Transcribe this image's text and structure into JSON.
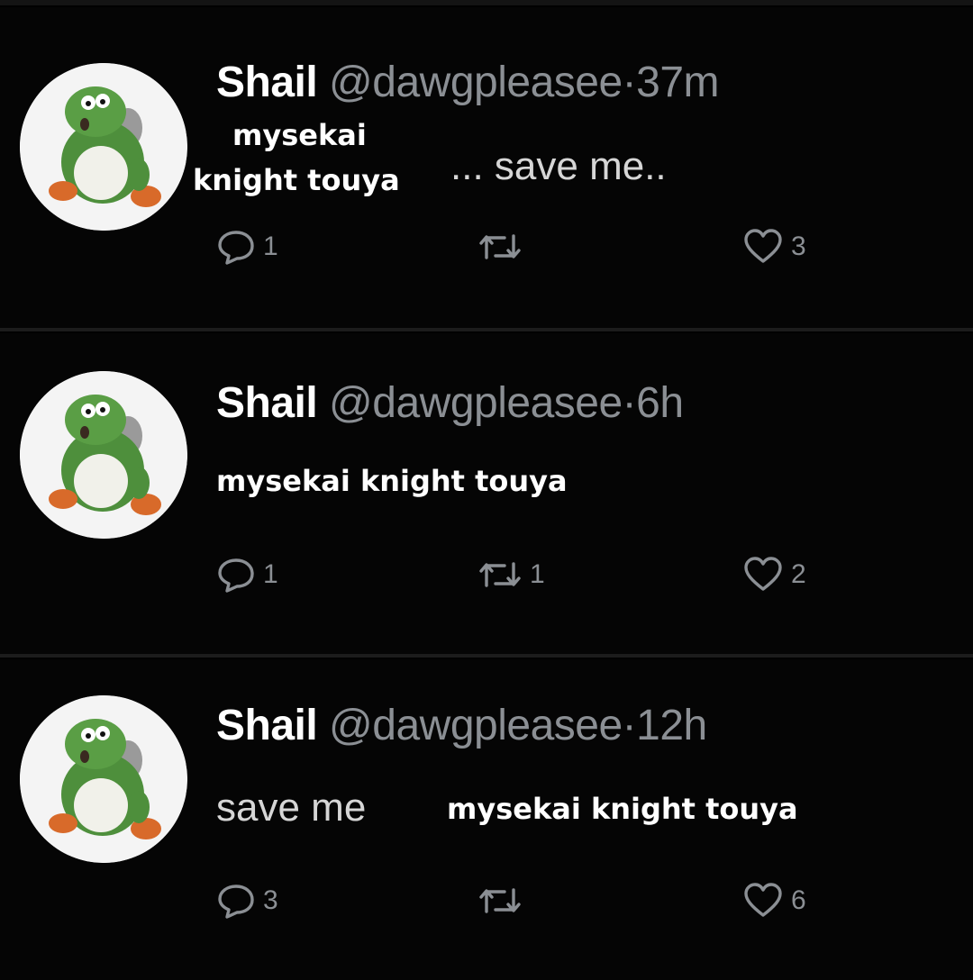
{
  "tweets": [
    {
      "author_name": "Shail",
      "handle": "@dawgpleasee",
      "separator": "·",
      "time": "37m",
      "text": "... save me..",
      "overlay_line1": "mysekai",
      "overlay_line2": "knight touya",
      "replies": "1",
      "retweets": "",
      "likes": "3"
    },
    {
      "author_name": "Shail",
      "handle": "@dawgpleasee",
      "separator": "·",
      "time": "6h",
      "text": "",
      "overlay_line1": "mysekai knight touya",
      "overlay_line2": "",
      "replies": "1",
      "retweets": "1",
      "likes": "2"
    },
    {
      "author_name": "Shail",
      "handle": "@dawgpleasee",
      "separator": "·",
      "time": "12h",
      "text": "save me",
      "overlay_line1": "mysekai knight touya",
      "overlay_line2": "",
      "replies": "3",
      "retweets": "",
      "likes": "6"
    }
  ],
  "icons": {
    "reply": "reply-icon",
    "retweet": "retweet-icon",
    "like": "heart-icon",
    "avatar": "yoshi-avatar"
  },
  "colors": {
    "background": "#000000",
    "name": "#ffffff",
    "meta": "#8b8f94",
    "avatar_green": "#4e8f3c"
  }
}
